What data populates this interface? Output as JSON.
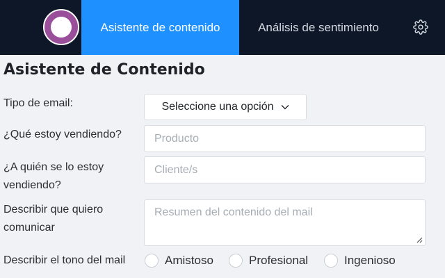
{
  "nav": {
    "tabs": [
      {
        "label": "Asistente de contenido",
        "active": true
      },
      {
        "label": "Análisis de sentimiento",
        "active": false
      }
    ]
  },
  "page": {
    "title": "Asistente de Contenido"
  },
  "form": {
    "email_type": {
      "label": "Tipo de email:",
      "selected": "Seleccione una opción"
    },
    "product": {
      "label": "¿Qué estoy vendiendo?",
      "placeholder": "Producto"
    },
    "client": {
      "label": "¿A quién se lo estoy vendiendo?",
      "placeholder": "Cliente/s"
    },
    "summary": {
      "label": "Describir que quiero comunicar",
      "placeholder": "Resumen del contenido del mail"
    },
    "tone": {
      "label": "Describir el tono del mail",
      "options": [
        "Amistoso",
        "Profesional",
        "Ingenioso"
      ]
    }
  },
  "colors": {
    "topbar": "#0d1727",
    "active_tab": "#1e90ff",
    "logo": "#9a4f9a"
  },
  "icons": {
    "settings": "gear-icon",
    "dropdown": "chevron-down-icon"
  }
}
